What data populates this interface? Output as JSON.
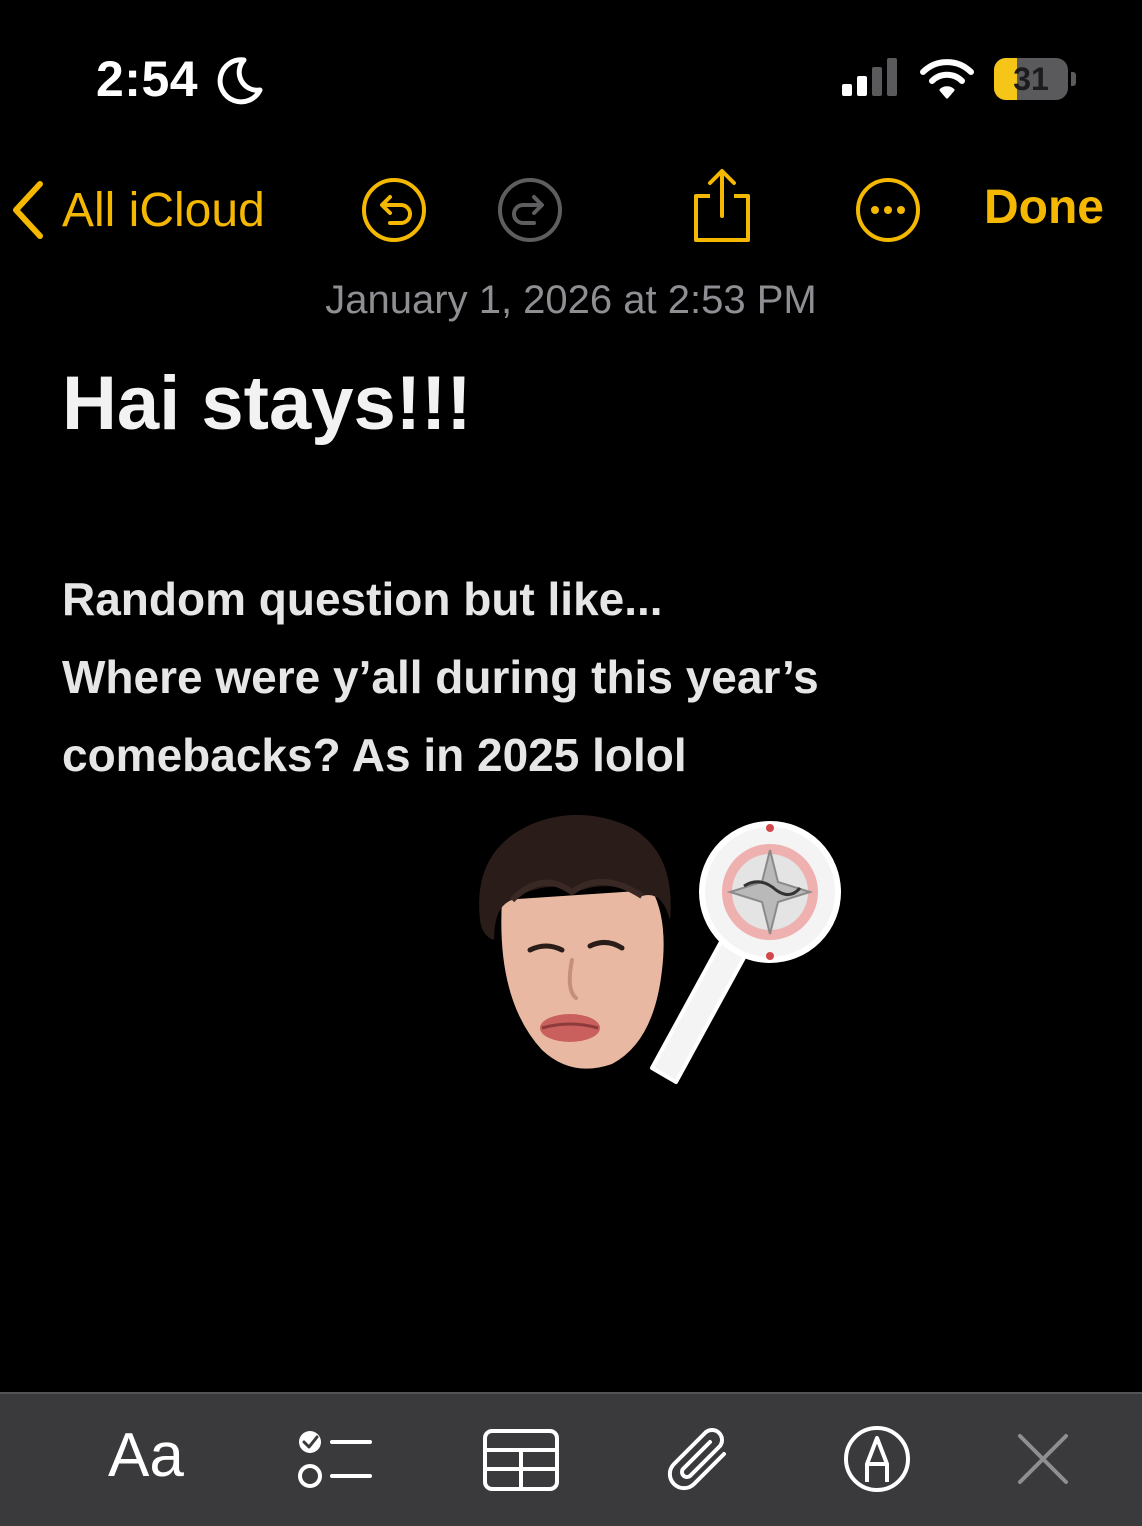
{
  "status_bar": {
    "time": "2:54",
    "battery_percent": 31,
    "battery_label": "31"
  },
  "nav": {
    "back_label": "All iCloud",
    "done_label": "Done"
  },
  "note": {
    "date": "January 1, 2026 at 2:53 PM",
    "title": "Hai stays!!!",
    "body_lines": [
      "Random question but like...",
      "Where were y’all during this year’s",
      "comebacks? As in 2025 lolol"
    ]
  },
  "toolbar": {
    "format_label": "Aa"
  },
  "colors": {
    "accent": "#f5b800",
    "background": "#000000",
    "toolbar": "#3a3a3c"
  },
  "icons": [
    "moon-icon",
    "signal-icon",
    "wifi-icon",
    "battery-icon",
    "chevron-left-icon",
    "undo-icon",
    "redo-icon",
    "share-icon",
    "more-icon",
    "checklist-icon",
    "table-icon",
    "paperclip-icon",
    "markup-pen-icon",
    "close-icon"
  ]
}
